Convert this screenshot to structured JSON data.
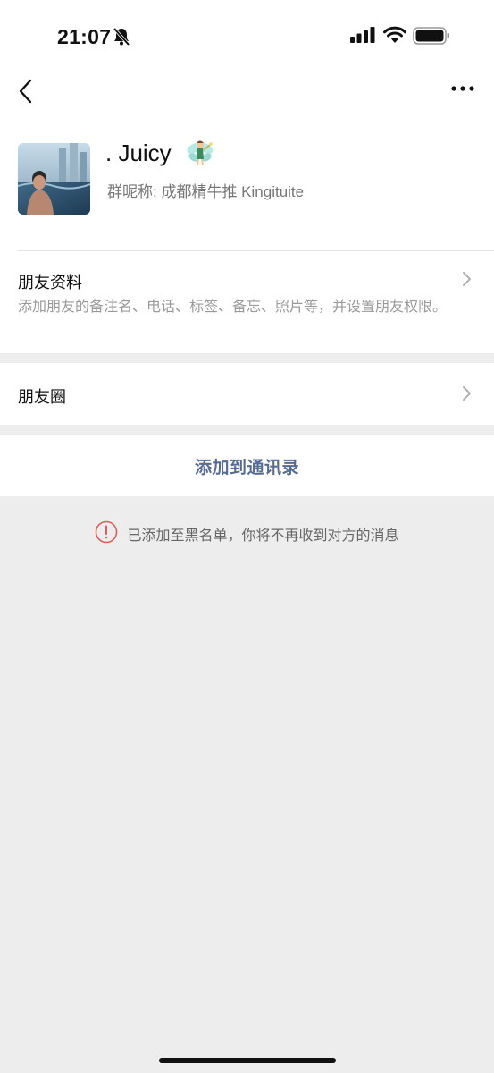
{
  "status_bar": {
    "time": "21:07"
  },
  "profile": {
    "name": ". Juicy",
    "group_nickname": "群昵称: 成都精牛推 Kingituite"
  },
  "friend_info": {
    "title": "朋友资料",
    "description": "添加朋友的备注名、电话、标签、备忘、照片等，并设置朋友权限。"
  },
  "moments": {
    "title": "朋友圈"
  },
  "add_button": {
    "label": "添加到通讯录"
  },
  "notice": {
    "text": "已添加至黑名单，你将不再收到对方的消息",
    "icon": "exclamation-circle-icon",
    "icon_color": "#e25c5c"
  },
  "colors": {
    "link": "#576b95",
    "background": "#ededed"
  }
}
